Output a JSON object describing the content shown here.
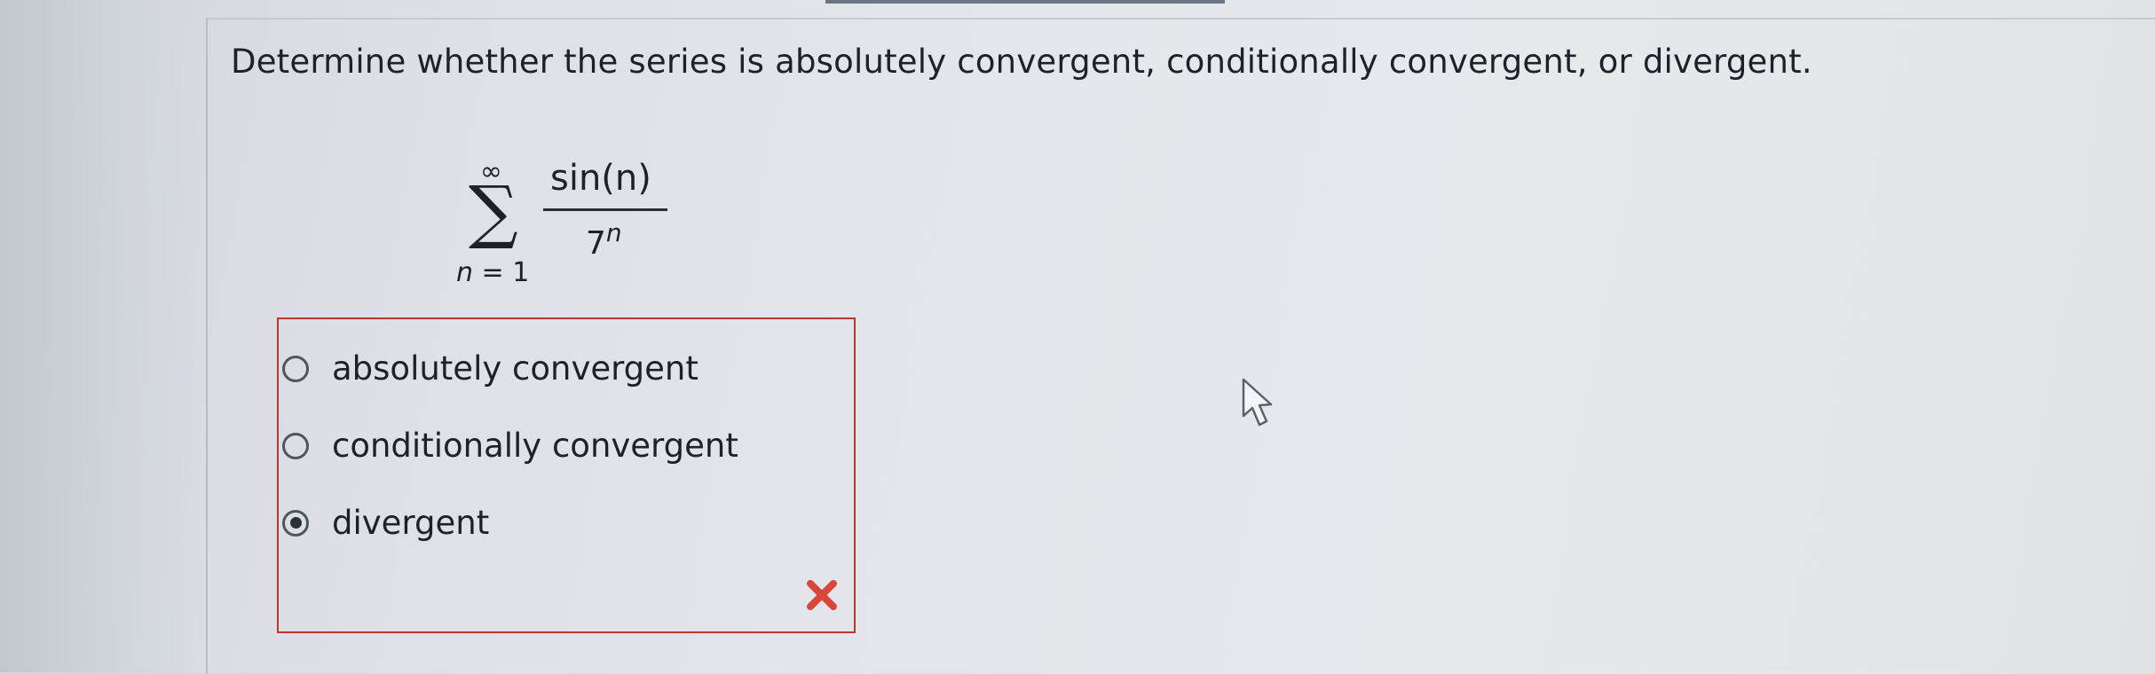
{
  "question": {
    "prompt": "Determine whether the series is absolutely convergent, conditionally convergent, or divergent."
  },
  "series": {
    "upper_limit": "∞",
    "sigma": "∑",
    "index_var": "n",
    "lower_eq": " = 1",
    "numerator": "sin(n)",
    "denominator_base": "7",
    "denominator_exp": "n"
  },
  "options": [
    {
      "label": "absolutely convergent",
      "selected": false
    },
    {
      "label": "conditionally convergent",
      "selected": false
    },
    {
      "label": "divergent",
      "selected": true
    }
  ],
  "feedback": {
    "status": "incorrect",
    "icon": "x-icon",
    "color": "#d9463a"
  },
  "colors": {
    "box_border": "#b23b30",
    "top_tab": "#6a7686"
  }
}
